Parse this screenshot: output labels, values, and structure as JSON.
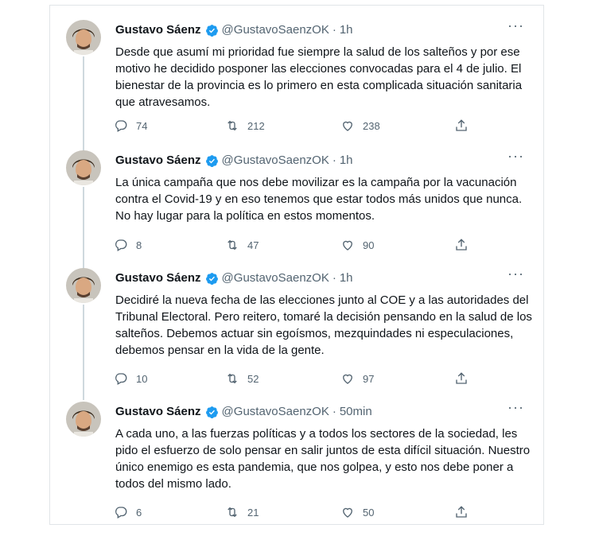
{
  "tweets": [
    {
      "name": "Gustavo Sáenz",
      "handle": "@GustavoSaenzOK",
      "time": "1h",
      "text": "Desde que asumí mi prioridad fue siempre la salud de los salteños y por ese motivo he decidido posponer las elecciones convocadas para el 4 de julio. El bienestar de la provincia es lo primero en esta complicada situación sanitaria que atravesamos.",
      "replies": "74",
      "retweets": "212",
      "likes": "238"
    },
    {
      "name": "Gustavo Sáenz",
      "handle": "@GustavoSaenzOK",
      "time": "1h",
      "text": "La única campaña que nos debe movilizar es la campaña por la vacunación contra el Covid-19 y en eso tenemos que estar todos más unidos que nunca. No hay lugar para la política en estos momentos.",
      "replies": "8",
      "retweets": "47",
      "likes": "90"
    },
    {
      "name": "Gustavo Sáenz",
      "handle": "@GustavoSaenzOK",
      "time": "1h",
      "text": "Decidiré la nueva fecha de las elecciones junto al COE y a las autoridades del Tribunal Electoral. Pero reitero, tomaré la decisión pensando en la salud de los salteños. Debemos actuar sin egoísmos, mezquindades ni especulaciones, debemos pensar en la vida de la gente.",
      "replies": "10",
      "retweets": "52",
      "likes": "97"
    },
    {
      "name": "Gustavo Sáenz",
      "handle": "@GustavoSaenzOK",
      "time": "50min",
      "text": "A cada uno, a las fuerzas políticas y a todos los sectores de la sociedad, les pido el esfuerzo de solo pensar en salir juntos de esta difícil situación. Nuestro único enemigo es esta pandemia, que nos golpea, y esto nos debe poner a todos del mismo lado.",
      "replies": "6",
      "retweets": "21",
      "likes": "50"
    }
  ],
  "colors": {
    "verified": "#1d9bf0",
    "muted": "#536471",
    "thread_line": "#cfd9de"
  },
  "icons": [
    "avatar",
    "verified-badge-icon",
    "more-options-icon",
    "reply-icon",
    "retweet-icon",
    "like-icon",
    "share-icon"
  ]
}
